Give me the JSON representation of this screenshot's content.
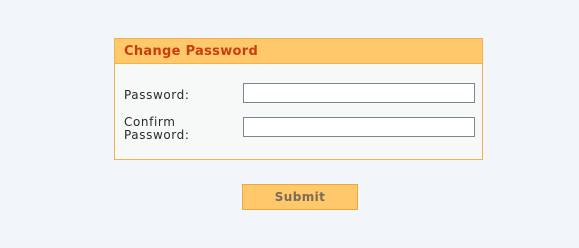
{
  "form": {
    "title": "Change Password",
    "password_label": "Password:",
    "password_value": "",
    "confirm_label_line1": "Confirm",
    "confirm_label_line2": "Password:",
    "confirm_value": "",
    "submit_label": "Submit"
  },
  "colors": {
    "header_background": "#ffc86a",
    "header_text": "#c63f10",
    "panel_border": "#f0b24e",
    "button_background": "#ffc86a",
    "button_text": "#7a6a5a"
  }
}
